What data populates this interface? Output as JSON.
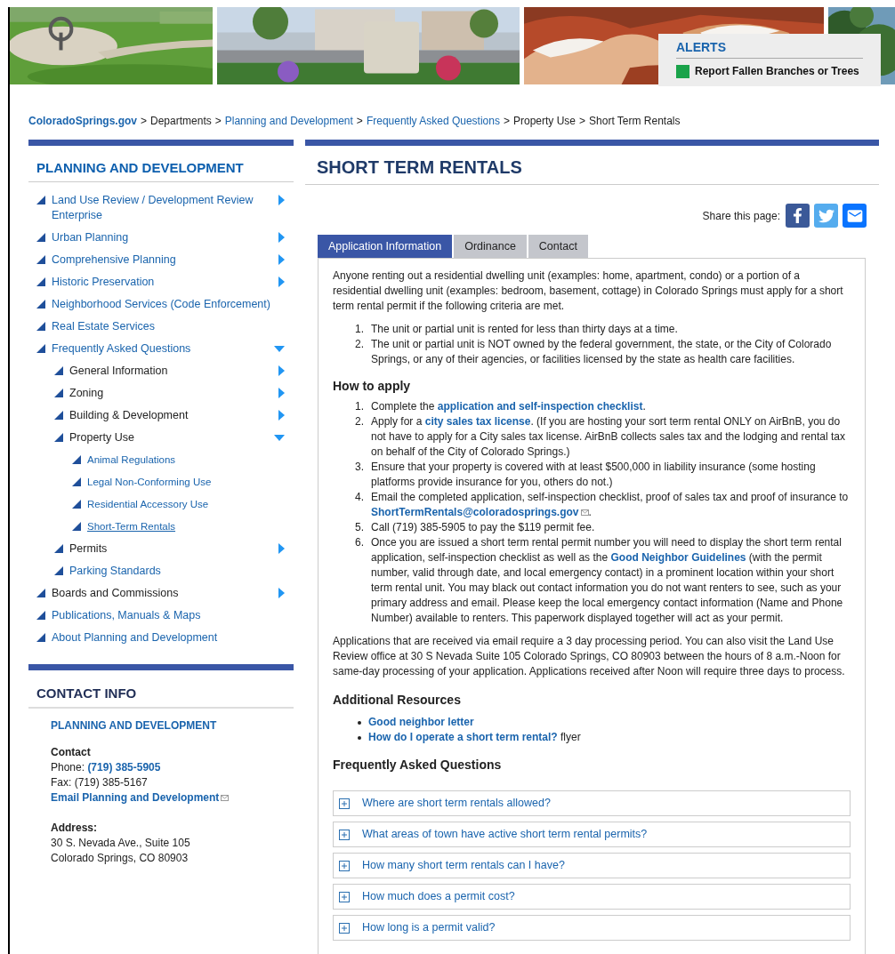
{
  "banner": {
    "alerts": {
      "title": "ALERTS",
      "items": [
        {
          "label": "Report Fallen Branches or Trees",
          "color": "#1aa34a"
        }
      ]
    }
  },
  "breadcrumb": {
    "separator": ">",
    "items": [
      {
        "label": "ColoradoSprings.gov",
        "kind": "home"
      },
      {
        "label": "Departments",
        "kind": "text"
      },
      {
        "label": "Planning and Development",
        "kind": "link"
      },
      {
        "label": "Frequently Asked Questions",
        "kind": "link"
      },
      {
        "label": "Property Use",
        "kind": "text"
      },
      {
        "label": "Short Term Rentals",
        "kind": "text"
      }
    ]
  },
  "sidebar": {
    "title": "PLANNING AND DEVELOPMENT",
    "items": [
      {
        "label": "Land Use Review / Development Review Enterprise",
        "link": true,
        "selected": false,
        "expanded": false
      },
      {
        "label": "Urban Planning",
        "link": true,
        "selected": false,
        "expanded": false
      },
      {
        "label": "Comprehensive Planning",
        "link": true,
        "selected": false,
        "expanded": false
      },
      {
        "label": "Historic Preservation",
        "link": true,
        "selected": false,
        "expanded": false
      },
      {
        "label": "Neighborhood Services (Code Enforcement)",
        "link": true,
        "selected": false
      },
      {
        "label": "Real Estate Services",
        "link": true,
        "selected": false
      },
      {
        "label": "Frequently Asked Questions",
        "link": true,
        "selected": false,
        "expanded": true,
        "children": [
          {
            "label": "General Information",
            "link": false,
            "selected": false,
            "expanded": false
          },
          {
            "label": "Zoning",
            "link": false,
            "selected": false,
            "expanded": false
          },
          {
            "label": "Building & Development",
            "link": false,
            "selected": false,
            "expanded": false
          },
          {
            "label": "Property Use",
            "link": false,
            "selected": false,
            "expanded": true,
            "children": [
              {
                "label": "Animal Regulations",
                "link": true,
                "selected": false
              },
              {
                "label": "Legal Non-Conforming Use",
                "link": true,
                "selected": false
              },
              {
                "label": "Residential Accessory Use",
                "link": true,
                "selected": false
              },
              {
                "label": "Short-Term Rentals",
                "link": true,
                "selected": true
              }
            ]
          },
          {
            "label": "Permits",
            "link": false,
            "selected": false,
            "expanded": false
          },
          {
            "label": "Parking Standards",
            "link": true,
            "selected": false
          }
        ]
      },
      {
        "label": "Boards and Commissions",
        "link": false,
        "selected": false,
        "expanded": false
      },
      {
        "label": "Publications, Manuals & Maps",
        "link": true,
        "selected": false
      },
      {
        "label": "About Planning and Development",
        "link": true,
        "selected": false
      }
    ]
  },
  "contact": {
    "title": "CONTACT INFO",
    "org": "PLANNING AND DEVELOPMENT",
    "contact_label": "Contact",
    "phone": [
      {
        "text": "Phone: ",
        "kind": "text"
      },
      {
        "text": "(719) 385-5905",
        "kind": "link"
      }
    ],
    "fax": "Fax: (719) 385-5167",
    "email": "Email Planning and Development",
    "address_label": "Address:",
    "address_lines": [
      "30 S. Nevada Ave., Suite 105",
      "Colorado Springs, CO 80903"
    ]
  },
  "main": {
    "title": "SHORT TERM RENTALS",
    "share_label": "Share this page:",
    "share_buttons": [
      {
        "kind": "facebook"
      },
      {
        "kind": "twitter"
      },
      {
        "kind": "email"
      }
    ],
    "tabs": [
      {
        "label": "Application Information",
        "selected": true
      },
      {
        "label": "Ordinance",
        "selected": false
      },
      {
        "label": "Contact",
        "selected": false
      }
    ],
    "intro": "Anyone renting out a residential dwelling unit (examples: home, apartment, condo) or a portion of a residential dwelling unit (examples: bedroom, basement, cottage) in Colorado Springs must apply for a short term rental permit if the following criteria are met.",
    "criteria": [
      {
        "number": "1.",
        "text": "The unit or partial unit is rented for less than thirty days at a time."
      },
      {
        "number": "2.",
        "text": "The unit or partial unit is NOT owned by the federal government, the state, or the City of Colorado Springs, or any of their agencies, or facilities licensed by the state as health care facilities."
      }
    ],
    "how_to_apply": {
      "heading": "How to apply",
      "steps": [
        {
          "number": "1.",
          "segments": [
            {
              "text": "Complete the ",
              "kind": "text"
            },
            {
              "text": "application and self-inspection checklist",
              "kind": "link"
            },
            {
              "text": ".",
              "kind": "text"
            }
          ]
        },
        {
          "number": "2.",
          "segments": [
            {
              "text": "Apply for a ",
              "kind": "text"
            },
            {
              "text": "city sales tax license",
              "kind": "link"
            },
            {
              "text": ". (If you are hosting your sort term rental ONLY on AirBnB, you do not have to apply for a City sales tax license. AirBnB collects sales tax and the lodging and rental tax on behalf of the City of Colorado Springs.)",
              "kind": "text"
            }
          ]
        },
        {
          "number": "3.",
          "segments": [
            {
              "text": "Ensure that your property is covered with at least $500,000 in liability insurance (some hosting platforms provide insurance for you, others do not.)",
              "kind": "text"
            }
          ]
        },
        {
          "number": "4.",
          "segments": [
            {
              "text": "Email the completed application, self-inspection checklist, proof of sales tax and proof of insurance to ",
              "kind": "text"
            },
            {
              "text": "ShortTermRentals@coloradosprings.gov",
              "kind": "mail"
            },
            {
              "text": ".",
              "kind": "text"
            }
          ]
        },
        {
          "number": "5.",
          "segments": [
            {
              "text": "Call (719) 385-5905 to pay the $119 permit fee.",
              "kind": "text"
            }
          ]
        },
        {
          "number": "6.",
          "segments": [
            {
              "text": "Once you are issued a short term rental permit number you will need to display the short term rental application, self-inspection checklist as well as the ",
              "kind": "text"
            },
            {
              "text": "Good Neighbor Guidelines",
              "kind": "link"
            },
            {
              "text": " (with the permit number, valid through date, and local emergency contact) in a prominent location within your short term rental unit. You may black out contact information you do not want renters to see, such as your primary address and email. Please keep the local emergency contact information (Name and Phone Number) available to renters. This paperwork displayed together will act as your permit.",
              "kind": "text"
            }
          ]
        }
      ]
    },
    "processing": "Applications that are received via email require a 3 day processing period. You can also visit the Land Use Review office at 30 S Nevada Suite 105 Colorado Springs, CO 80903 between the hours of 8 a.m.-Noon for same-day processing of your application. Applications received after Noon will require three days to process.",
    "resources": {
      "heading": "Additional Resources",
      "items": [
        [
          {
            "text": "Good neighbor letter",
            "kind": "link"
          }
        ],
        [
          {
            "text": "How do I operate a short term rental?",
            "kind": "link"
          },
          {
            "text": " flyer",
            "kind": "text"
          }
        ]
      ]
    },
    "faq": {
      "heading": "Frequently Asked Questions",
      "items": [
        {
          "question": "Where are short term rentals allowed?",
          "expanded": false
        },
        {
          "question": "What areas of town have active short term rental permits?",
          "expanded": false
        },
        {
          "question": "How many short term rentals can I have?",
          "expanded": false
        },
        {
          "question": "How much does a permit cost?",
          "expanded": false
        },
        {
          "question": "How long is a permit valid?",
          "expanded": false
        }
      ]
    }
  }
}
